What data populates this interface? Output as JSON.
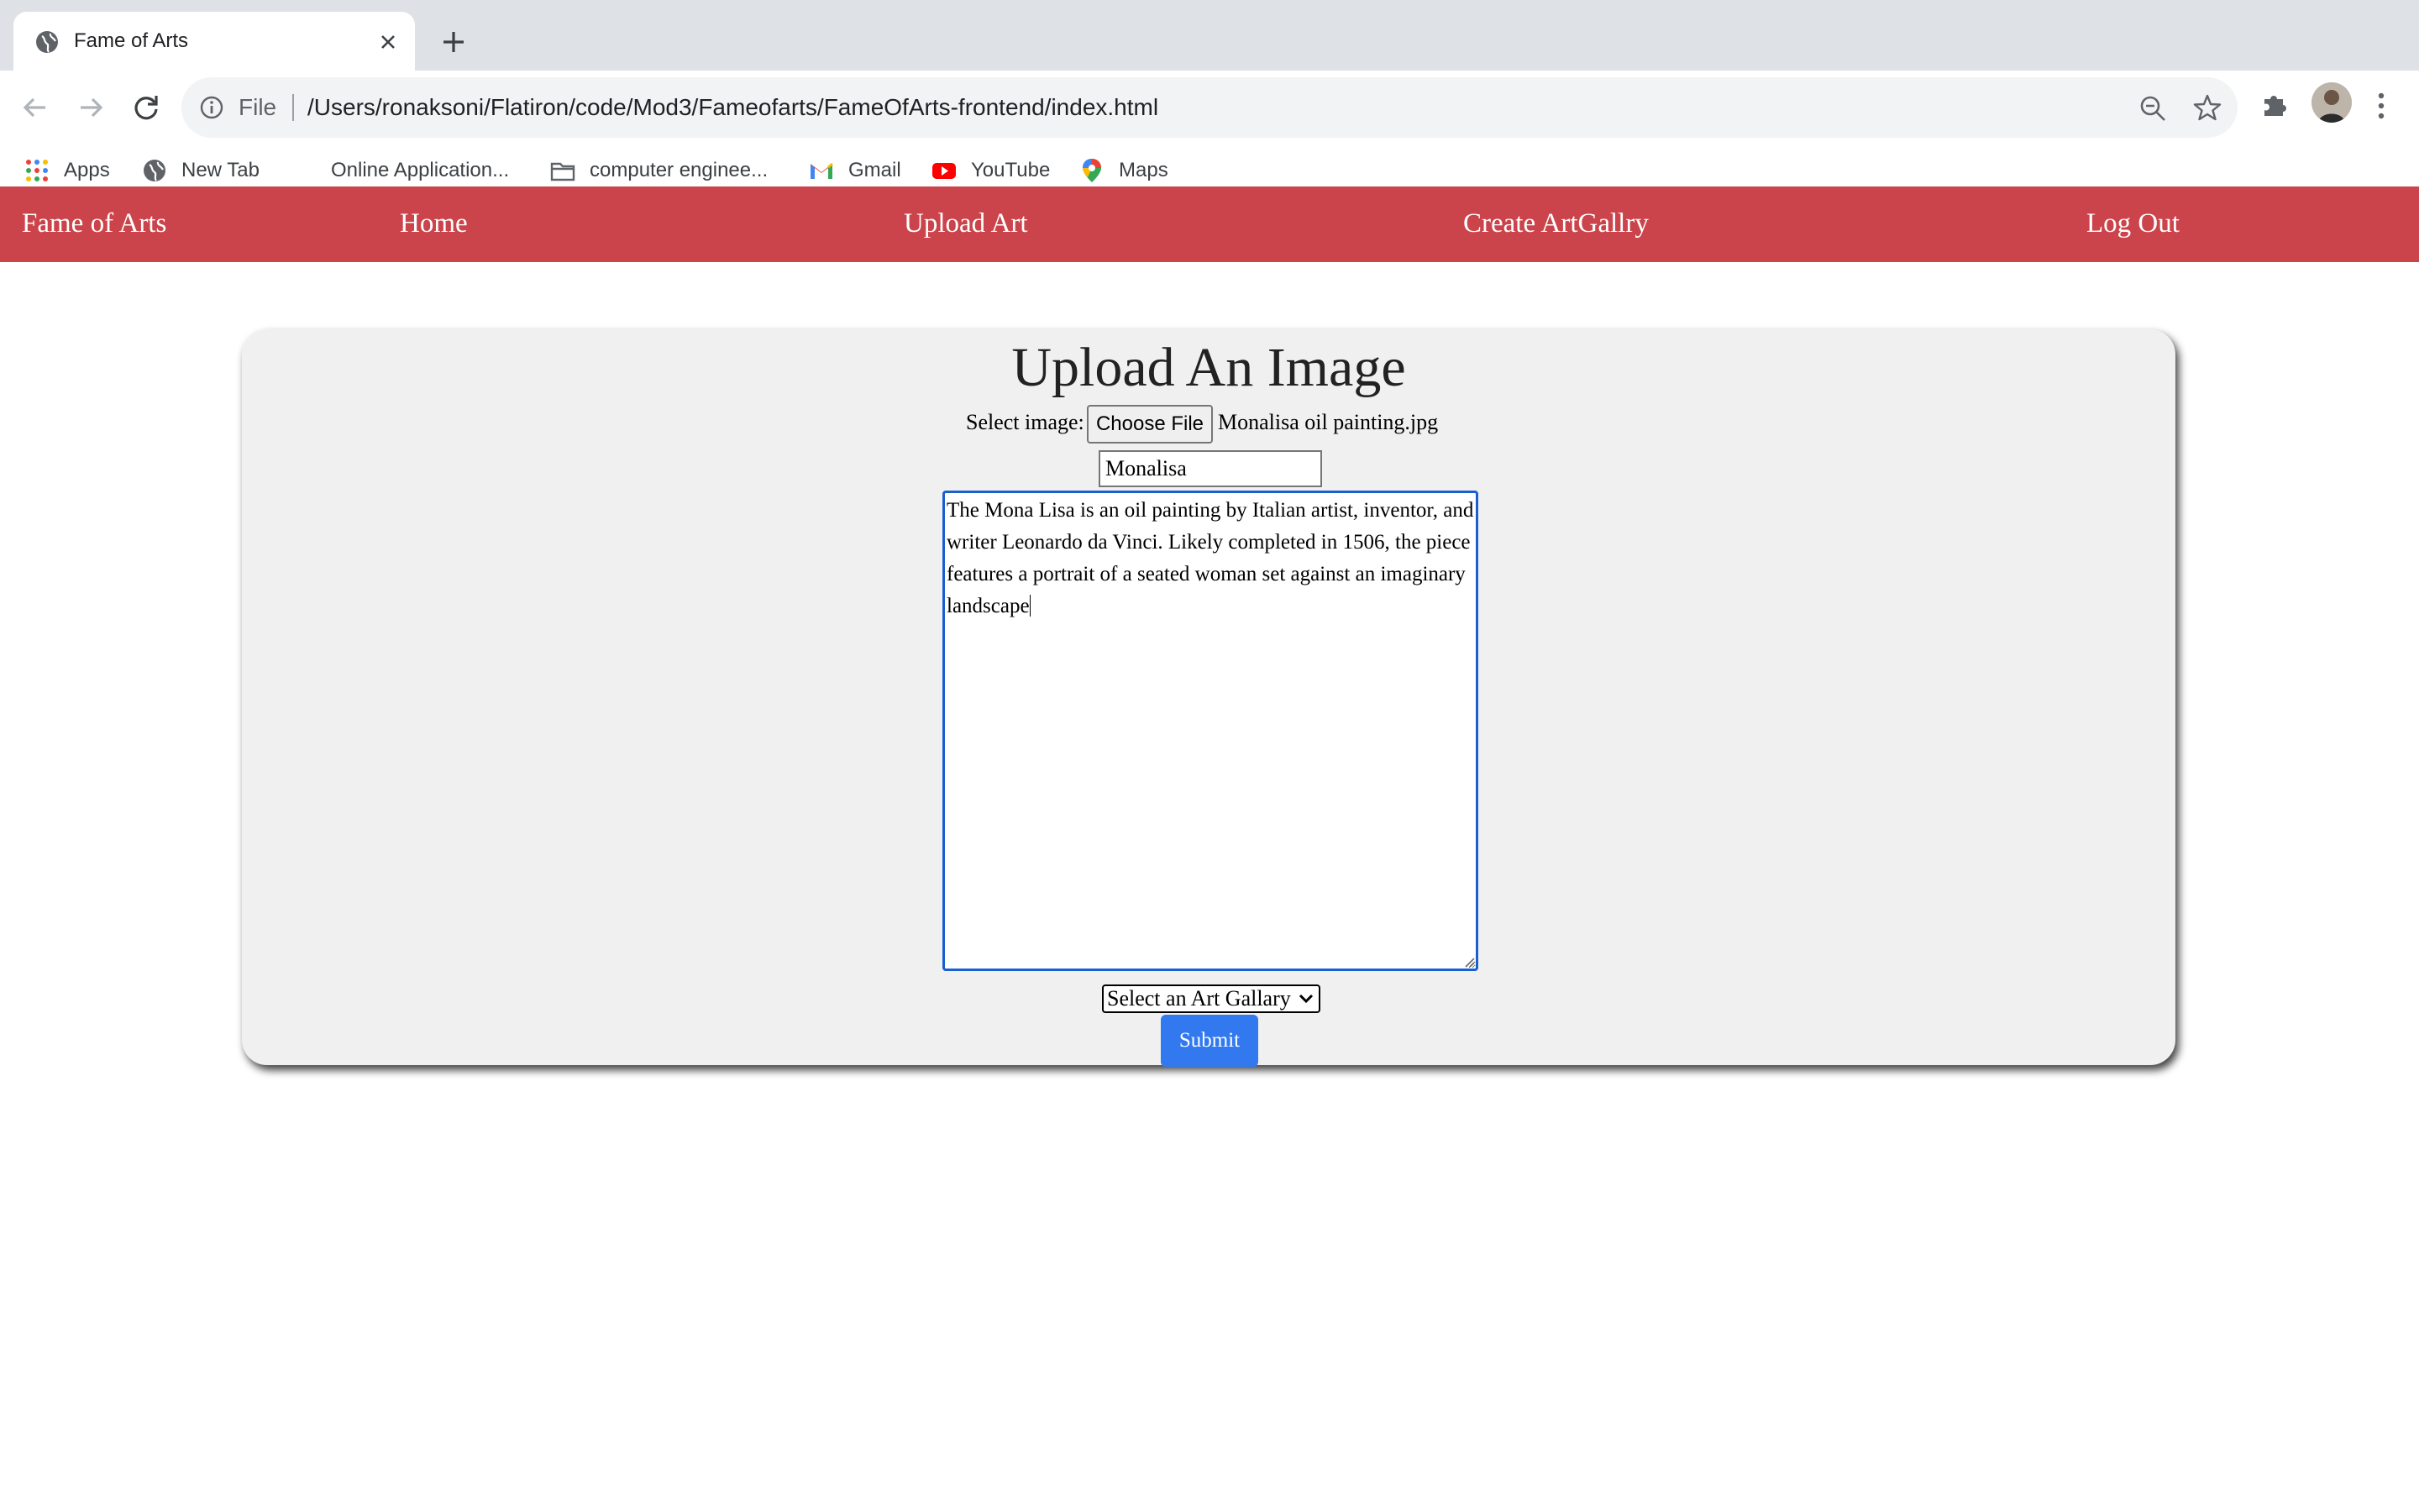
{
  "browser": {
    "tab_title": "Fame of Arts",
    "url_scheme": "File",
    "url": "/Users/ronaksoni/Flatiron/code/Mod3/Fameofarts/FameOfArts-frontend/index.html",
    "bookmarks": [
      {
        "label": "Apps",
        "icon": "apps-grid-icon"
      },
      {
        "label": "New Tab",
        "icon": "globe-icon"
      },
      {
        "label": "Online Application...",
        "icon": "blank-page-icon"
      },
      {
        "label": "computer enginee...",
        "icon": "folder-icon"
      },
      {
        "label": "Gmail",
        "icon": "gmail-icon"
      },
      {
        "label": "YouTube",
        "icon": "youtube-icon"
      },
      {
        "label": "Maps",
        "icon": "maps-pin-icon"
      }
    ]
  },
  "navbar": {
    "brand": "Fame of Arts",
    "home": "Home",
    "upload_art": "Upload Art",
    "create_gallery": "Create ArtGallry",
    "logout": "Log Out",
    "color": "#cc444b"
  },
  "form": {
    "heading": "Upload An Image",
    "select_image_label": "Select image:",
    "choose_file_label": "Choose File",
    "chosen_file_name": "Monalisa oil painting.jpg",
    "title_value": "Monalisa",
    "description_value": "The Mona Lisa is an oil painting by Italian artist, inventor, and writer Leonardo da Vinci. Likely completed in 1506, the piece features a portrait of a seated woman set against an imaginary landscape",
    "gallery_select_value": "Select an Art Gallary",
    "submit_label": "Submit",
    "submit_color": "#3279f0"
  }
}
